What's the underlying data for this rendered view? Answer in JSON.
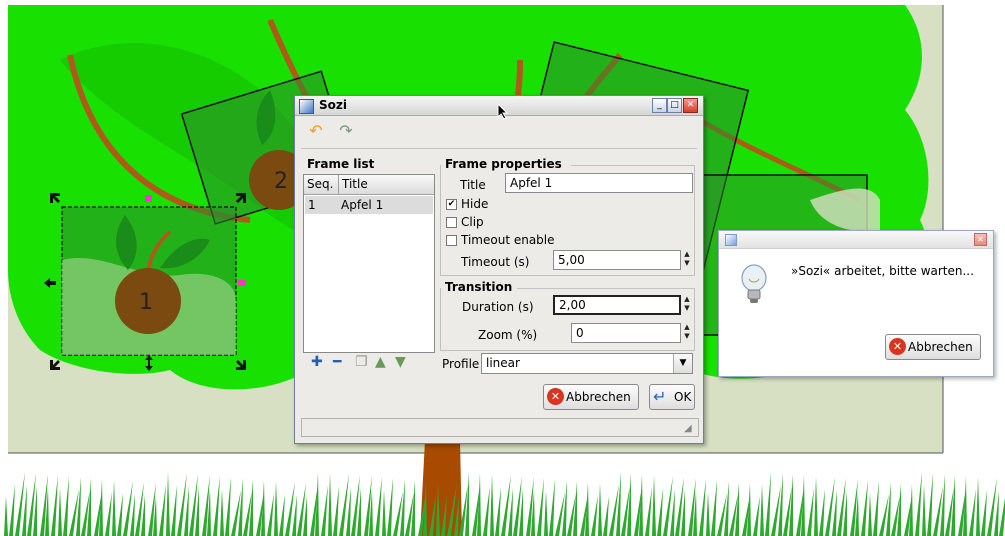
{
  "sozi_dialog": {
    "title": "Sozi",
    "toolbar": {
      "undo_icon": "undo-arrow-icon",
      "redo_icon": "redo-arrow-icon"
    },
    "frame_list": {
      "title": "Frame list",
      "columns": [
        "Seq.",
        "Title"
      ],
      "rows": [
        {
          "seq": "1",
          "title": "Apfel 1"
        }
      ],
      "tools": [
        "add-icon",
        "remove-icon",
        "duplicate-icon",
        "move-up-icon",
        "move-down-icon"
      ]
    },
    "frame_properties": {
      "title": "Frame properties",
      "title_label": "Title",
      "title_value": "Apfel 1",
      "hide_label": "Hide",
      "hide_checked": true,
      "clip_label": "Clip",
      "clip_checked": false,
      "timeout_enable_label": "Timeout enable",
      "timeout_enable_checked": false,
      "timeout_label": "Timeout (s)",
      "timeout_value": "5,00"
    },
    "transition": {
      "title": "Transition",
      "duration_label": "Duration (s)",
      "duration_value": "2,00",
      "zoom_label": "Zoom (%)",
      "zoom_value": "0",
      "profile_label": "Profile",
      "profile_value": "linear"
    },
    "buttons": {
      "cancel": "Abbrechen",
      "ok": "OK"
    }
  },
  "progress_dialog": {
    "message": "»Sozi« arbeitet, bitte warten...",
    "cancel": "Abbrechen"
  },
  "canvas": {
    "frame_labels": [
      "1",
      "2"
    ],
    "colors": {
      "foliage": "#18e000",
      "trunk": "#a84a00",
      "apple": "#7a4a10",
      "grass": "#2fa82f",
      "background": "#d7e0c3"
    }
  }
}
